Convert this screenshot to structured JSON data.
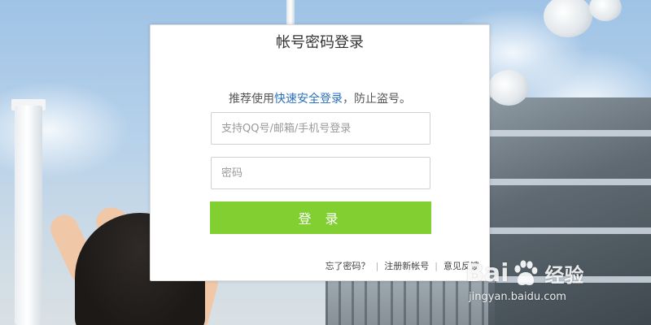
{
  "login": {
    "title": "帐号密码登录",
    "subtitle_prefix": "推荐使用",
    "subtitle_link": "快速安全登录",
    "subtitle_suffix": "，防止盗号。",
    "account_placeholder": "支持QQ号/邮箱/手机号登录",
    "password_placeholder": "密码",
    "login_button": "登 录",
    "footer": {
      "forgot_password": "忘了密码？",
      "register": "注册新帐号",
      "feedback": "意见反馈"
    }
  },
  "watermark": {
    "brand_left": "Bai",
    "brand_right": "经验",
    "url": "jingyan.baidu.com"
  },
  "colors": {
    "accent_green": "#82cf32",
    "link_blue": "#2a6fbd"
  }
}
